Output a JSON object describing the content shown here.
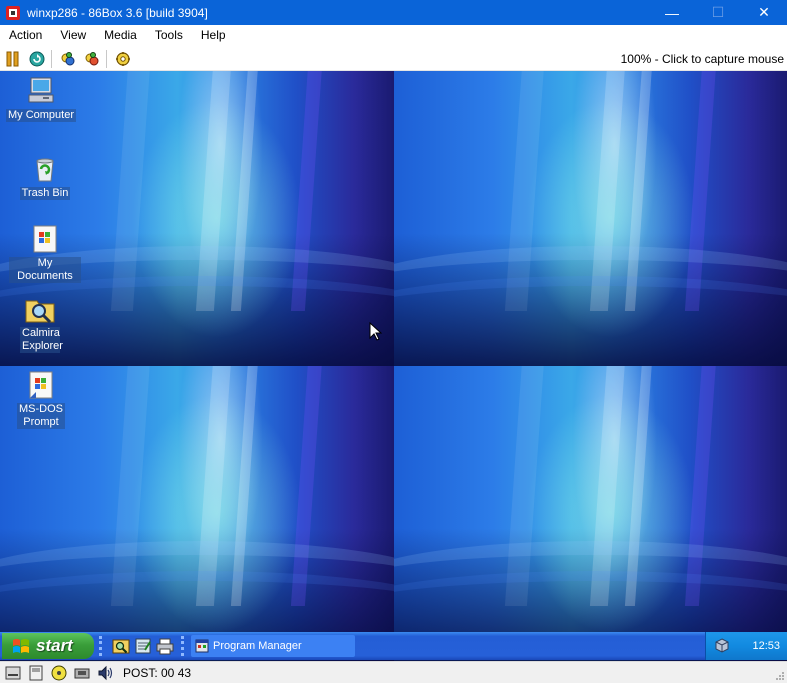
{
  "window": {
    "title": "winxp286 - 86Box 3.6 [build 3904]",
    "minimize_glyph": "—",
    "maximize_glyph": "☐",
    "close_glyph": "✕"
  },
  "menubar": {
    "items": [
      "Action",
      "View",
      "Media",
      "Tools",
      "Help"
    ]
  },
  "toolbar": {
    "buttons": [
      "pause-icon",
      "reset-icon",
      "ctrl-alt-del-icon",
      "ctrl-alt-esc-icon",
      "settings-icon"
    ],
    "status_text": "100% - Click to capture mouse"
  },
  "desktop": {
    "icons": [
      {
        "label": "My Computer",
        "icon": "computer-icon"
      },
      {
        "label": "Trash Bin",
        "icon": "recycle-bin-icon"
      },
      {
        "label": "My Documents",
        "icon": "documents-icon"
      },
      {
        "label": "Calmira Explorer",
        "icon": "explorer-icon"
      },
      {
        "label": "MS-DOS Prompt",
        "icon": "dos-prompt-icon"
      }
    ]
  },
  "taskbar": {
    "start_label": "start",
    "quick_launch": [
      "explorer-icon",
      "notepad-icon",
      "printer-icon"
    ],
    "task_label": "Program Manager",
    "clock": "12:53"
  },
  "statusbar": {
    "post_text": "POST: 00 43"
  },
  "colors": {
    "titlebar": "#0a64d8",
    "taskbar": "#245ed6",
    "start_button": "#3a9e3a",
    "tray": "#128ae0"
  }
}
